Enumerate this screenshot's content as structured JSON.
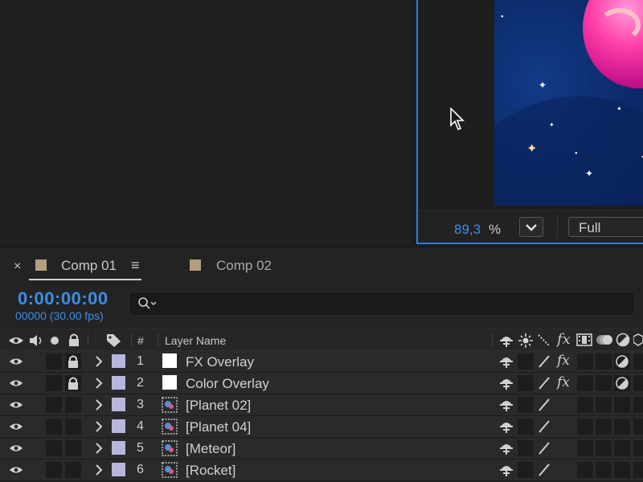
{
  "viewer": {
    "zoom_value": "89,3",
    "zoom_unit": "%",
    "resolution": "Full"
  },
  "timeline": {
    "tabs": [
      {
        "label": "Comp 01",
        "active": true
      },
      {
        "label": "Comp 02",
        "active": false
      }
    ],
    "close_glyph": "×",
    "menu_glyph": "≡",
    "timecode": "0:00:00:00",
    "frame_info": "00000 (30.00 fps)",
    "search": {
      "placeholder": "",
      "value": ""
    },
    "headers": {
      "number": "#",
      "layer_name": "Layer Name"
    },
    "layers": [
      {
        "num": "1",
        "name": "FX Overlay",
        "type": "solid",
        "locked": true,
        "fx": true,
        "adjustment": true
      },
      {
        "num": "2",
        "name": "Color Overlay",
        "type": "solid",
        "locked": true,
        "fx": true,
        "adjustment": true
      },
      {
        "num": "3",
        "name": "[Planet 02]",
        "type": "comp",
        "locked": false,
        "fx": false,
        "adjustment": false
      },
      {
        "num": "4",
        "name": "[Planet 04]",
        "type": "comp",
        "locked": false,
        "fx": false,
        "adjustment": false
      },
      {
        "num": "5",
        "name": "[Meteor]",
        "type": "comp",
        "locked": false,
        "fx": false,
        "adjustment": false
      },
      {
        "num": "6",
        "name": "[Rocket]",
        "type": "comp",
        "locked": false,
        "fx": false,
        "adjustment": false
      }
    ]
  },
  "colors": {
    "accent": "#3a8ee6",
    "layer_label": "#b8b6da",
    "comp_swatch": "#b29f80",
    "viewer_border": "#2d7de0"
  },
  "icons": {
    "cursor": "arrow-cursor-icon",
    "eye": "eye-icon",
    "lock": "lock-icon",
    "fx": "fx-icon"
  }
}
